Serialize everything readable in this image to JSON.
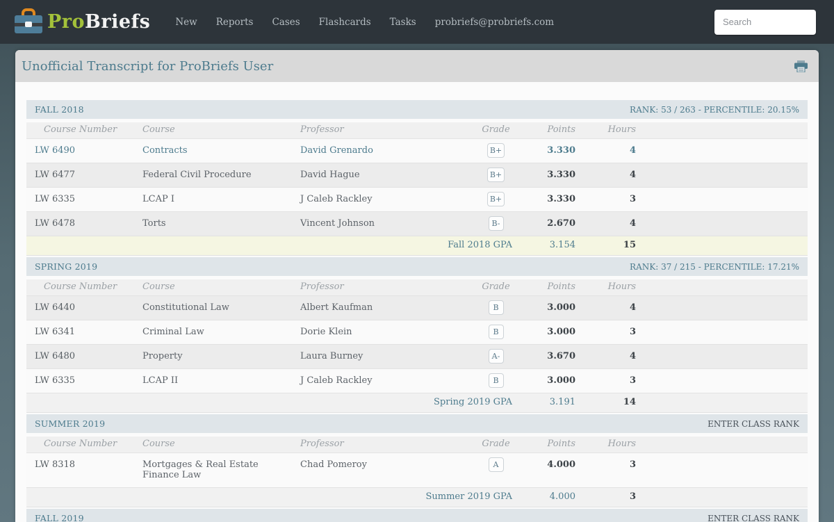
{
  "navbar": {
    "brand": {
      "pro": "Pro",
      "rest": "Briefs"
    },
    "items": [
      "New",
      "Reports",
      "Cases",
      "Flashcards",
      "Tasks",
      "probriefs@probriefs.com"
    ],
    "search": {
      "placeholder": "Search"
    }
  },
  "page": {
    "title": "Unofficial Transcript for ProBriefs User"
  },
  "table_columns": [
    "Course Number",
    "Course",
    "Professor",
    "Grade",
    "Points",
    "Hours"
  ],
  "colors": {
    "accent_teal": "#4d7b8d",
    "brand_green": "#a3c13a",
    "navbar_bg": "#2d343a",
    "gpa_highlight": "#f5f6e2",
    "briefcase_blue": "#4e7d99",
    "briefcase_handle_orange": "#e0891f"
  },
  "semesters": [
    {
      "name": "FALL 2018",
      "right_text": "RANK: 53 / 263 - PERCENTILE: 20.15%",
      "right_is_link": false,
      "alt_stripe": false,
      "rows": [
        {
          "number": "LW 6490",
          "course": "Contracts",
          "professor": "David Grenardo",
          "grade": "B+",
          "points": "3.330",
          "hours": "4",
          "active": true
        },
        {
          "number": "LW 6477",
          "course": "Federal Civil Procedure",
          "professor": "David Hague",
          "grade": "B+",
          "points": "3.330",
          "hours": "4",
          "active": false
        },
        {
          "number": "LW 6335",
          "course": "LCAP I",
          "professor": "J Caleb Rackley",
          "grade": "B+",
          "points": "3.330",
          "hours": "3",
          "active": false
        },
        {
          "number": "LW 6478",
          "course": "Torts",
          "professor": "Vincent Johnson",
          "grade": "B-",
          "points": "2.670",
          "hours": "4",
          "active": false
        }
      ],
      "gpa": {
        "label": "Fall 2018 GPA",
        "points": "3.154",
        "hours": "15",
        "highlight": true
      }
    },
    {
      "name": "SPRING 2019",
      "right_text": "RANK: 37 / 215 - PERCENTILE: 17.21%",
      "right_is_link": false,
      "alt_stripe": true,
      "rows": [
        {
          "number": "LW 6440",
          "course": "Constitutional Law",
          "professor": "Albert Kaufman",
          "grade": "B",
          "points": "3.000",
          "hours": "4",
          "active": false
        },
        {
          "number": "LW 6341",
          "course": "Criminal Law",
          "professor": "Dorie Klein",
          "grade": "B",
          "points": "3.000",
          "hours": "3",
          "active": false
        },
        {
          "number": "LW 6480",
          "course": "Property",
          "professor": "Laura Burney",
          "grade": "A-",
          "points": "3.670",
          "hours": "4",
          "active": false
        },
        {
          "number": "LW 6335",
          "course": "LCAP II",
          "professor": "J Caleb Rackley",
          "grade": "B",
          "points": "3.000",
          "hours": "3",
          "active": false
        }
      ],
      "gpa": {
        "label": "Spring 2019 GPA",
        "points": "3.191",
        "hours": "14",
        "highlight": false
      }
    },
    {
      "name": "SUMMER 2019",
      "right_text": "ENTER CLASS RANK",
      "right_is_link": true,
      "alt_stripe": false,
      "rows": [
        {
          "number": "LW 8318",
          "course": "Mortgages & Real Estate Finance Law",
          "professor": "Chad Pomeroy",
          "grade": "A",
          "points": "4.000",
          "hours": "3",
          "active": false
        }
      ],
      "gpa": {
        "label": "Summer 2019 GPA",
        "points": "4.000",
        "hours": "3",
        "highlight": false
      }
    },
    {
      "name": "FALL 2019",
      "right_text": "ENTER CLASS RANK",
      "right_is_link": true,
      "alt_stripe": false,
      "rows": [],
      "gpa": null
    }
  ]
}
